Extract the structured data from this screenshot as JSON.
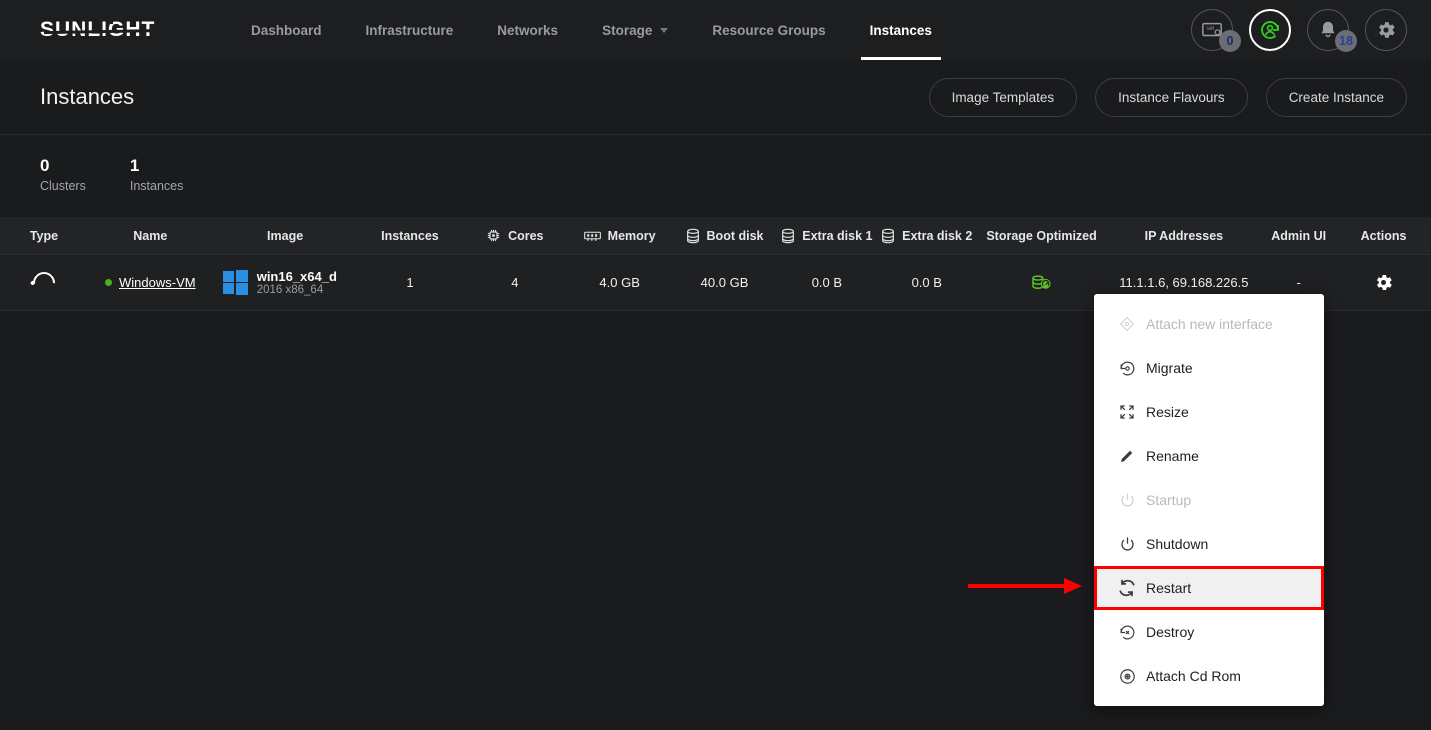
{
  "brand": {
    "logo_text": "SUNLIGHT"
  },
  "nav": {
    "items": [
      {
        "label": "Dashboard",
        "active": false,
        "caret": false
      },
      {
        "label": "Infrastructure",
        "active": false,
        "caret": false
      },
      {
        "label": "Networks",
        "active": false,
        "caret": false
      },
      {
        "label": "Storage",
        "active": false,
        "caret": true
      },
      {
        "label": "Resource Groups",
        "active": false,
        "caret": false
      },
      {
        "label": "Instances",
        "active": true,
        "caret": false
      }
    ],
    "icons": [
      {
        "name": "console-icon",
        "badge": "0"
      },
      {
        "name": "sync-user-icon",
        "badge": ""
      },
      {
        "name": "bell-icon",
        "badge": "18"
      },
      {
        "name": "gear-icon",
        "badge": ""
      }
    ]
  },
  "page": {
    "title": "Instances",
    "buttons": [
      {
        "label": "Image Templates"
      },
      {
        "label": "Instance Flavours"
      },
      {
        "label": "Create Instance"
      }
    ]
  },
  "stats": [
    {
      "value": "0",
      "label": "Clusters"
    },
    {
      "value": "1",
      "label": "Instances"
    }
  ],
  "table": {
    "headers": [
      {
        "label": "Type",
        "icon": ""
      },
      {
        "label": "Name",
        "icon": ""
      },
      {
        "label": "Image",
        "icon": ""
      },
      {
        "label": "Instances",
        "icon": ""
      },
      {
        "label": "Cores",
        "icon": "cpu-chip-icon"
      },
      {
        "label": "Memory",
        "icon": "memory-icon"
      },
      {
        "label": "Boot disk",
        "icon": "disk-icon"
      },
      {
        "label": "Extra disk 1",
        "icon": "disk-icon"
      },
      {
        "label": "Extra disk 2",
        "icon": "disk-icon"
      },
      {
        "label": "Storage Optimized",
        "icon": ""
      },
      {
        "label": "IP Addresses",
        "icon": ""
      },
      {
        "label": "Admin UI",
        "icon": ""
      },
      {
        "label": "Actions",
        "icon": ""
      }
    ],
    "row": {
      "type_icon": "spinner-icon",
      "status": "running",
      "name": "Windows-VM",
      "image_name": "win16_x64_d",
      "image_sub": "2016 x86_64",
      "instances": "1",
      "cores": "4",
      "memory": "4.0 GB",
      "boot_disk": "40.0 GB",
      "extra_disk_1": "0.0 B",
      "extra_disk_2": "0.0 B",
      "storage_optimized_icon": "storage-optimized-icon",
      "ip_addresses": "11.1.1.6, 69.168.226.5",
      "admin_ui": "-",
      "actions_icon": "gear-icon"
    }
  },
  "menu": {
    "items": [
      {
        "label": "Attach new interface",
        "icon": "attach-interface-icon",
        "disabled": true,
        "highlight": false
      },
      {
        "label": "Migrate",
        "icon": "migrate-icon",
        "disabled": false,
        "highlight": false
      },
      {
        "label": "Resize",
        "icon": "resize-icon",
        "disabled": false,
        "highlight": false
      },
      {
        "label": "Rename",
        "icon": "pencil-icon",
        "disabled": false,
        "highlight": false
      },
      {
        "label": "Startup",
        "icon": "power-icon",
        "disabled": true,
        "highlight": false
      },
      {
        "label": "Shutdown",
        "icon": "power-icon",
        "disabled": false,
        "highlight": false
      },
      {
        "label": "Restart",
        "icon": "restart-icon",
        "disabled": false,
        "highlight": true
      },
      {
        "label": "Destroy",
        "icon": "destroy-icon",
        "disabled": false,
        "highlight": false
      },
      {
        "label": "Attach Cd Rom",
        "icon": "cdrom-icon",
        "disabled": false,
        "highlight": false
      }
    ]
  },
  "annotation": {
    "arrow_color": "#ff0000",
    "highlight_color": "#ff0000"
  },
  "colors": {
    "background": "#1a1b1d",
    "nav_background": "#1d1e20",
    "table_header": "#232426",
    "row_background": "#1f2022",
    "accent_green": "#4caf1f",
    "windows_blue": "#2a8fe0"
  }
}
